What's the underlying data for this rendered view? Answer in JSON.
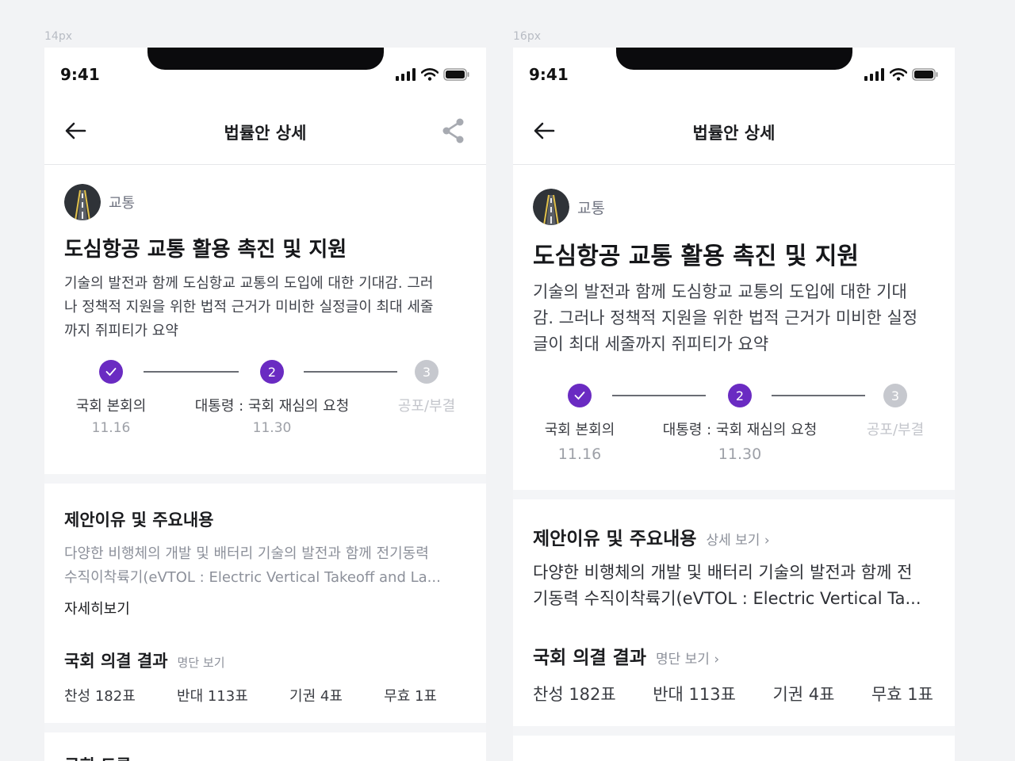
{
  "frames": [
    {
      "size_label": "14px",
      "status": {
        "time": "9:41"
      },
      "nav": {
        "title": "법률안 상세",
        "back_icon": "arrow-left-icon",
        "share_icon": "share-icon"
      },
      "bill": {
        "category": "교통",
        "title": "도심항공 교통 활용 촉진 및 지원",
        "summary_lines": [
          "기술의 발전과 함께 도심항교 교통의 도입에 대한 기대감. 그러",
          "나 정책적 지원을 위한 법적 근거가 미비한 실정글이 최대 세줄",
          "까지 쥐피티가 요약"
        ]
      },
      "steps": [
        {
          "num": "1",
          "label": "국회 본회의",
          "date": "11.16",
          "state": "done"
        },
        {
          "num": "2",
          "label": "대통령 : 국회 재심의 요청",
          "date": "11.30",
          "state": "current"
        },
        {
          "num": "3",
          "label": "공포/부결",
          "date": "",
          "state": "upcoming"
        }
      ],
      "reason": {
        "title": "제안이유 및 주요내용",
        "lines": [
          "다양한 비행체의 개발 및 배터리 기술의 발전과 함께 전기동력",
          "수직이착륙기(eVTOL : Electric Vertical Takeoff and La..."
        ],
        "more": "자세히보기"
      },
      "result": {
        "title": "국회 의결 결과",
        "link": "명단 보기",
        "votes": [
          "찬성 182표",
          "반대 113표",
          "기권 4표",
          "무효 1표"
        ]
      },
      "next_title": "국회 토론"
    },
    {
      "size_label": "16px",
      "status": {
        "time": "9:41"
      },
      "nav": {
        "title": "법률안 상세",
        "back_icon": "arrow-left-icon"
      },
      "bill": {
        "category": "교통",
        "title": "도심항공 교통 활용 촉진 및 지원",
        "summary_lines": [
          "기술의 발전과 함께 도심항교 교통의 도입에 대한 기대",
          "감. 그러나 정책적 지원을 위한 법적 근거가 미비한 실정",
          "글이 최대 세줄까지 쥐피티가 요약"
        ]
      },
      "steps": [
        {
          "num": "1",
          "label": "국회 본회의",
          "date": "11.16",
          "state": "done"
        },
        {
          "num": "2",
          "label": "대통령 : 국회 재심의 요청",
          "date": "11.30",
          "state": "current"
        },
        {
          "num": "3",
          "label": "공포/부결",
          "date": "",
          "state": "upcoming"
        }
      ],
      "reason": {
        "title": "제안이유 및 주요내용",
        "link": "상세 보기",
        "lines": [
          "다양한 비행체의 개발 및 배터리 기술의 발전과 함께 전",
          "기동력 수직이착륙기(eVTOL : Electric Vertical Ta..."
        ]
      },
      "result": {
        "title": "국회 의결 결과",
        "link": "명단 보기",
        "votes": [
          "찬성 182표",
          "반대 113표",
          "기권 4표",
          "무효 1표"
        ]
      }
    }
  ],
  "colors": {
    "accent": "#6a2bc2",
    "inactive": "#c6c8ce",
    "divider": "#6a6d74"
  }
}
